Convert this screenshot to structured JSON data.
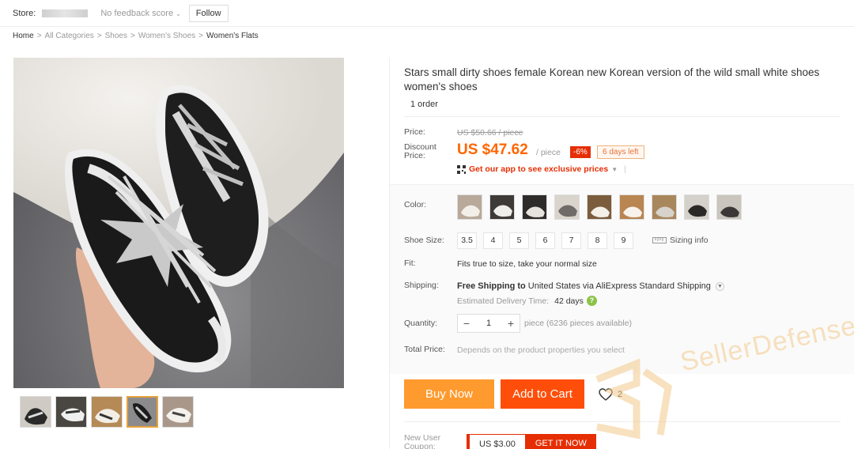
{
  "store": {
    "label": "Store:",
    "feedback": "No feedback score",
    "follow": "Follow"
  },
  "breadcrumb": [
    "Home",
    "All Categories",
    "Shoes",
    "Women's Shoes",
    "Women's Flats"
  ],
  "product": {
    "title": "Stars small dirty shoes female Korean new Korean version of the wild small white shoes women's shoes",
    "orders": "1 order",
    "price_label": "Price:",
    "original_price": "US $50.66 / piece",
    "discount_label": "Discount Price:",
    "price": "US $47.62",
    "per_piece": "/ piece",
    "discount_badge": "-6%",
    "days_left": "6 days left",
    "app_promo": "Get our app to see exclusive prices"
  },
  "options": {
    "color_label": "Color:",
    "color_swatch_count": 9,
    "size_label": "Shoe Size:",
    "sizes": [
      "3.5",
      "4",
      "5",
      "6",
      "7",
      "8",
      "9"
    ],
    "sizing_info": "Sizing info",
    "fit_label": "Fit:",
    "fit_text": "Fits true to size, take your normal size"
  },
  "shipping": {
    "label": "Shipping:",
    "free": "Free Shipping to",
    "destination": "United States via AliExpress Standard Shipping",
    "eta_label": "Estimated Delivery Time:",
    "eta_value": "42 days"
  },
  "quantity": {
    "label": "Quantity:",
    "value": "1",
    "minus": "−",
    "plus": "+",
    "note": "piece (6236 pieces available)"
  },
  "total": {
    "label": "Total Price:",
    "note": "Depends on the product properties you select"
  },
  "actions": {
    "buy_now": "Buy Now",
    "add_to_cart": "Add to Cart",
    "wishlist_count": "2"
  },
  "coupon": {
    "label": "New User Coupon:",
    "amount": "US $3.00",
    "get": "GET IT NOW"
  },
  "watermark": "SellerDefense",
  "colors": {
    "price_orange": "#ff6600",
    "buy_now_bg": "#ff9a2e",
    "add_to_cart_bg": "#ff4e0a",
    "badge_red": "#e62e04"
  },
  "icons": [
    "qr-code-icon",
    "chevron-down-icon",
    "ruler-icon",
    "help-icon",
    "heart-icon"
  ]
}
